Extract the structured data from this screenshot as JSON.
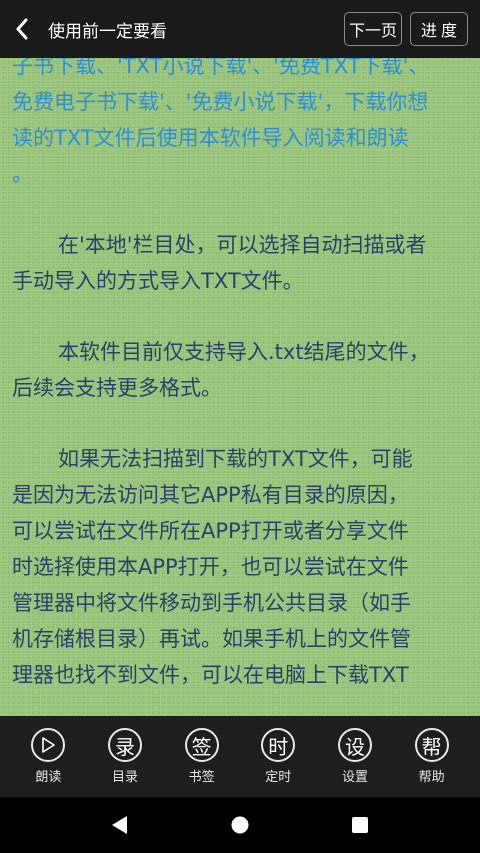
{
  "header": {
    "title": "使用前一定要看",
    "next_page_label": "下一页",
    "progress_label": "进度"
  },
  "content": {
    "link_paragraph": [
      "子书下载、'TXT小说下载'、'免费TXT下载'、",
      "免费电子书下载'、'免费小说下载'，下载你想",
      "读的TXT文件后使用本软件导入阅读和朗读",
      "。"
    ],
    "paragraph_1": [
      "在'本地'栏目处，可以选择自动扫描或者",
      "手动导入的方式导入TXT文件。"
    ],
    "paragraph_2": [
      "本软件目前仅支持导入.txt结尾的文件，",
      "后续会支持更多格式。"
    ],
    "paragraph_3": [
      "如果无法扫描到下载的TXT文件，可能",
      "是因为无法访问其它APP私有目录的原因，",
      "可以尝试在文件所在APP打开或者分享文件",
      "时选择使用本APP打开，也可以尝试在文件",
      "管理器中将文件移动到手机公共目录（如手",
      "机存储根目录）再试。如果手机上的文件管",
      "理器也找不到文件，可以在电脑上下载TXT"
    ],
    "colors": {
      "background": "#98c47a",
      "text": "#2c3f6b",
      "link": "#2f8fd6"
    }
  },
  "toolbar": {
    "items": [
      {
        "icon": "play-icon",
        "glyph": "▷",
        "label": "朗读"
      },
      {
        "icon": "catalog-icon",
        "glyph": "录",
        "label": "目录"
      },
      {
        "icon": "bookmark-icon",
        "glyph": "签",
        "label": "书签"
      },
      {
        "icon": "timer-icon",
        "glyph": "时",
        "label": "定时"
      },
      {
        "icon": "settings-icon",
        "glyph": "设",
        "label": "设置"
      },
      {
        "icon": "help-icon",
        "glyph": "帮",
        "label": "帮助"
      }
    ]
  }
}
